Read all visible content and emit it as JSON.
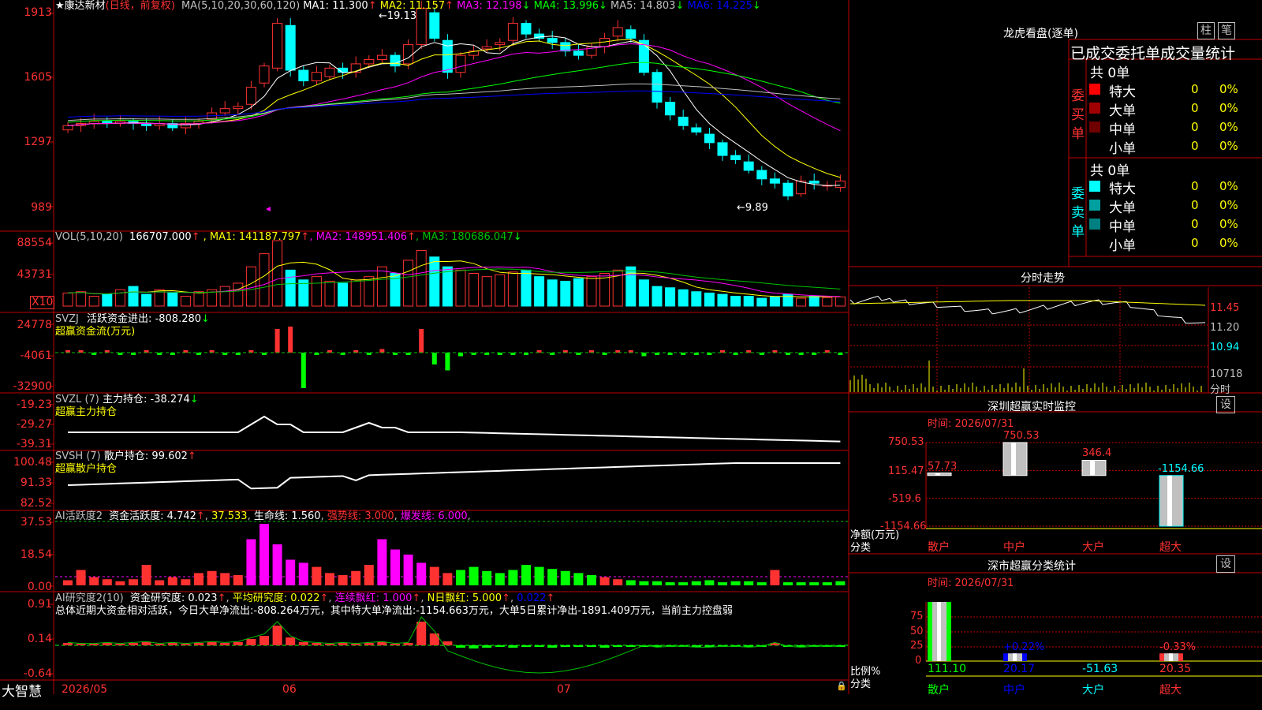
{
  "brand": "大智慧",
  "colors": {
    "grid": "#c00000",
    "up": "#ff3232",
    "down": "#00ffff",
    "ma1": "#ffffff",
    "ma2": "#ffff00",
    "ma3": "#ff00ff",
    "ma4": "#00ff00",
    "ma5": "#c0c0c0",
    "ma6": "#0000ff",
    "vol_ma3": "#00c000"
  },
  "main": {
    "title_star": "★",
    "stock_name": "康达新材",
    "period": "(日线，前复权)",
    "ma_label": "MA(5,10,20,30,60,120)",
    "ma": [
      {
        "label": "MA1:",
        "value": "11.300",
        "arrow": "↑",
        "color": "#ffffff"
      },
      {
        "label": "MA2:",
        "value": "11.157",
        "arrow": "↑",
        "color": "#ffff00"
      },
      {
        "label": "MA3:",
        "value": "12.198",
        "arrow": "↓",
        "color": "#ff00ff"
      },
      {
        "label": "MA4:",
        "value": "13.996",
        "arrow": "↓",
        "color": "#00ff00"
      },
      {
        "label": "MA5:",
        "value": "14.803",
        "arrow": "↓",
        "color": "#c0c0c0"
      },
      {
        "label": "MA6:",
        "value": "14.225",
        "arrow": "↓",
        "color": "#0000ff"
      }
    ],
    "y_labels": [
      "1913",
      "1605",
      "1297",
      "989"
    ],
    "high_note": "←19.13",
    "low_note": "←9.89"
  },
  "vol": {
    "label": "VOL(5,10,20)",
    "value": "166707.000",
    "arrow": "↑",
    "ma": [
      {
        "label": "MA1:",
        "value": "141187.797",
        "arrow": "↑",
        "color": "#ffff00"
      },
      {
        "label": "MA2:",
        "value": "148951.406",
        "arrow": "↑",
        "color": "#ff00ff"
      },
      {
        "label": "MA3:",
        "value": "180686.047",
        "arrow": "↓",
        "color": "#00c000"
      }
    ],
    "y_labels": [
      "88554",
      "43731"
    ],
    "unit": "X10"
  },
  "svzj": {
    "name": "SVZJ",
    "desc": "活跃资金进出:",
    "value": "-808.280",
    "arrow": "↓",
    "sub": "超赢资金流(万元)",
    "y_labels": [
      "24778",
      "-4061",
      "-32900"
    ]
  },
  "svzl": {
    "name": "SVZL",
    "param": "(7)",
    "desc": "主力持仓:",
    "value": "-38.274",
    "arrow": "↓",
    "sub": "超赢主力持仓",
    "y_labels": [
      "-19.23",
      "-29.27",
      "-39.31"
    ]
  },
  "svsh": {
    "name": "SVSH",
    "param": "(7)",
    "desc": "散户持仓:",
    "value": "99.602",
    "arrow": "↑",
    "sub": "超赢散户持仓",
    "y_labels": [
      "100.48",
      "91.33",
      "82.52"
    ]
  },
  "ai1": {
    "name": "AI活跃度2",
    "desc": "资金活跃度:",
    "value": "4.742",
    "arrow": "↑",
    "v2": "37.533",
    "life_label": "生命线:",
    "life": "1.560",
    "strong_label": "强势线:",
    "strong": "3.000",
    "burst_label": "爆发线:",
    "burst": "6.000",
    "y_labels": [
      "37.53",
      "18.54",
      "0.00"
    ]
  },
  "ai2": {
    "name": "AI研究度2(10)",
    "desc": "资金研究度:",
    "value": "0.023",
    "arrow": "↑",
    "avg_label": "平均研究度:",
    "avg": "0.022",
    "red_label": "连续飘红:",
    "red": "1.000",
    "nred_label": "N日飘红:",
    "nred": "5.000",
    "last": "0.022",
    "summary": "总体近期大资金相对活跃，今日大单净流出:-808.264万元，其中特大单净流出:-1154.663万元，大单5日累计净出-1891.409万元，当前主力控盘弱",
    "y_labels": [
      "0.91",
      "0.14",
      "-0.64"
    ]
  },
  "xaxis": {
    "labels": [
      "2026/05",
      "06",
      "07"
    ]
  },
  "lhb": {
    "title": "龙虎看盘(逐单)",
    "btn1": "柱",
    "btn2": "笔",
    "header": "已成交委托单成交量统计",
    "buy": {
      "side": "委买单",
      "total": "共 0单",
      "rows": [
        {
          "label": "特大",
          "count": "0",
          "pct": "0%",
          "color": "#ff0000"
        },
        {
          "label": "大单",
          "count": "0",
          "pct": "0%",
          "color": "#a00000"
        },
        {
          "label": "中单",
          "count": "0",
          "pct": "0%",
          "color": "#700000"
        },
        {
          "label": "小单",
          "count": "0",
          "pct": "0%",
          "color": "#000000"
        }
      ]
    },
    "sell": {
      "side": "委卖单",
      "total": "共 0单",
      "rows": [
        {
          "label": "特大",
          "count": "0",
          "pct": "0%",
          "color": "#00ffff"
        },
        {
          "label": "大单",
          "count": "0",
          "pct": "0%",
          "color": "#00a0a0"
        },
        {
          "label": "中单",
          "count": "0",
          "pct": "0%",
          "color": "#008080"
        },
        {
          "label": "小单",
          "count": "0",
          "pct": "0%",
          "color": "#000000"
        }
      ]
    }
  },
  "intraday": {
    "title": "分时走势",
    "y_labels": [
      "11.45",
      "11.20",
      "10.94"
    ],
    "vol_label": "10718",
    "vol_unit": "分时"
  },
  "monitor": {
    "title": "深圳超赢实时监控",
    "btn": "设",
    "time": "时间: 2026/07/31",
    "y_labels": [
      "750.53",
      "115.47",
      "-519.6",
      "-1154.66"
    ],
    "ylabel1": "净额(万元)",
    "ylabel2": "分类",
    "cats": [
      "散户",
      "中户",
      "大户",
      "超大"
    ],
    "values": [
      57.73,
      750.53,
      346.4,
      -1154.66
    ],
    "value_labels": [
      "57.73",
      "750.53",
      "346.4",
      "-1154.66"
    ],
    "ymin": -1154.66,
    "ymax": 750.53
  },
  "classify": {
    "title": "深市超赢分类统计",
    "btn": "设",
    "time": "时间: 2026/07/31",
    "y_labels": [
      "75",
      "50",
      "25",
      "0"
    ],
    "ylabel1": "比例%",
    "ylabel2": "分类",
    "cats": [
      "散户",
      "中户",
      "大户",
      "超大"
    ],
    "ratios": [
      100,
      13,
      0,
      13
    ],
    "ratio_labels": [
      "",
      "+0.22%",
      "",
      "-0.33%"
    ],
    "bottom_values": [
      "111.10",
      "20.17",
      "-51.63",
      "20.35"
    ]
  }
}
